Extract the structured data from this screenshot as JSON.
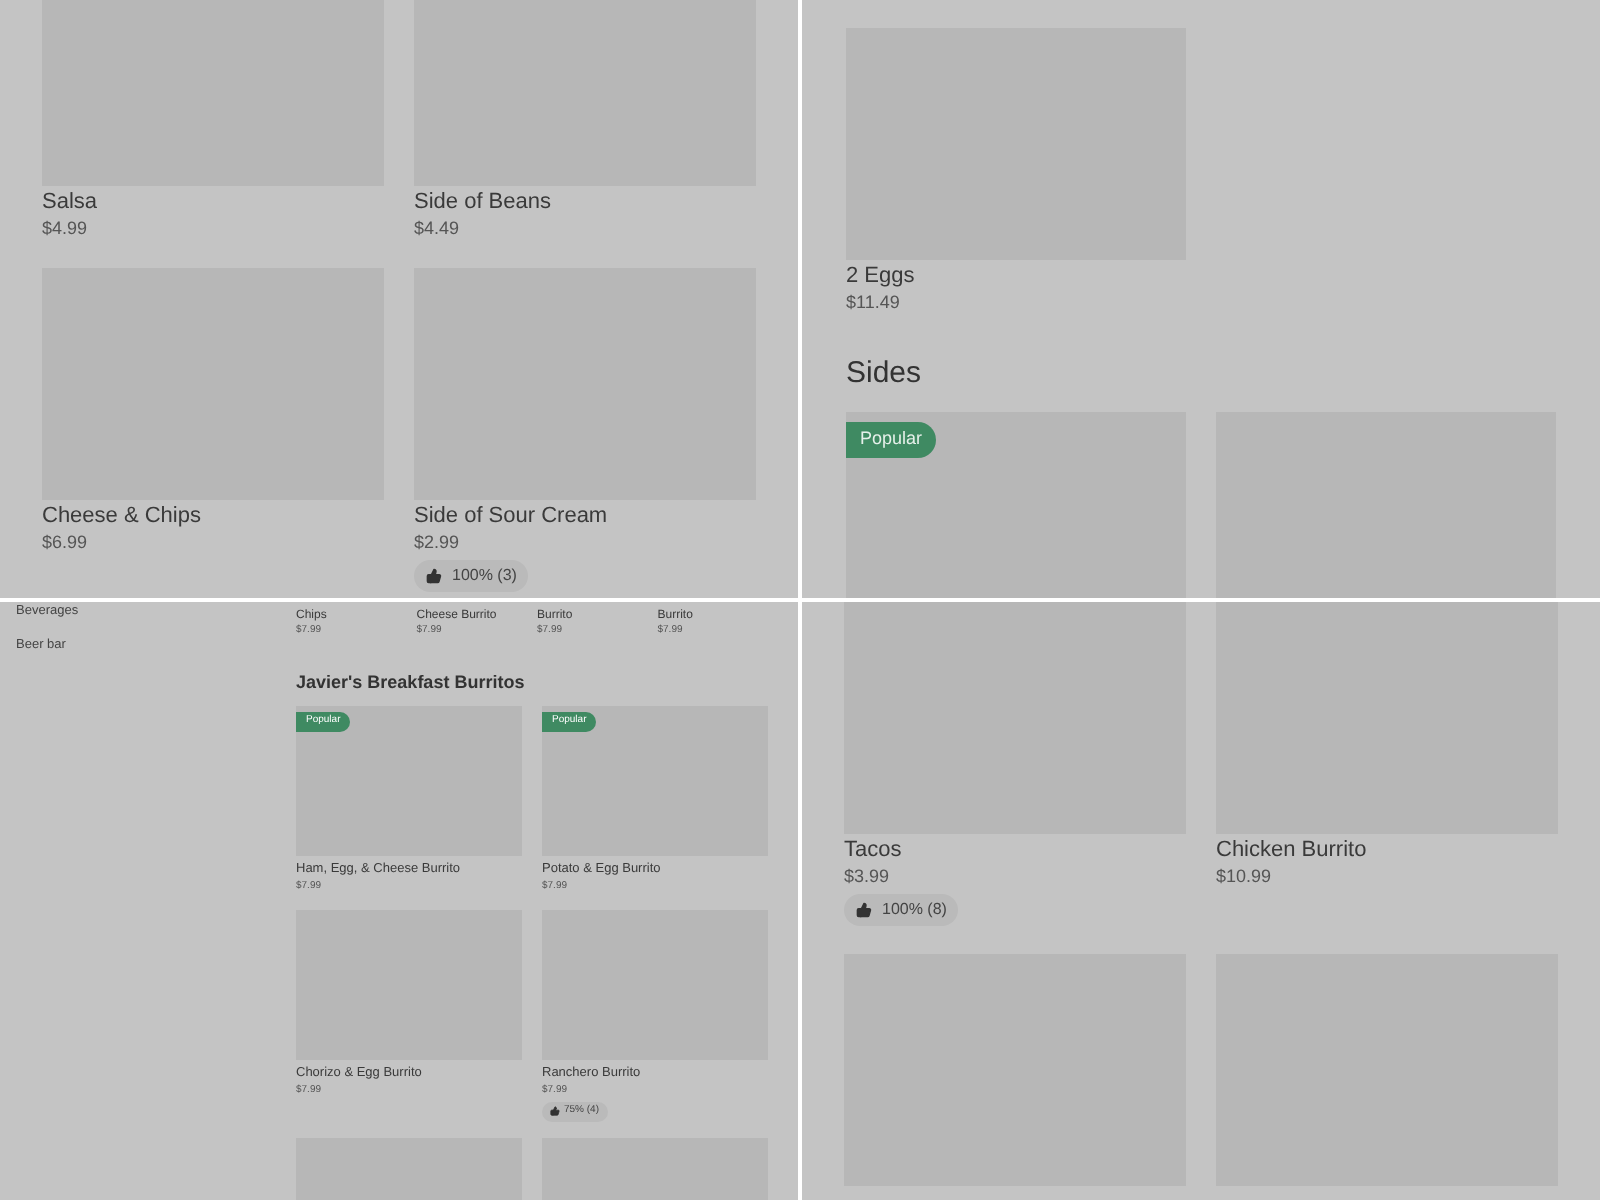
{
  "panels": [
    {
      "kind": "grid",
      "items": [
        {
          "kind": "dish",
          "name": "Salsa",
          "price": "$4.99"
        },
        {
          "kind": "dish",
          "name": "Side of Beans",
          "price": "$4.49"
        },
        {
          "kind": "dish",
          "name": "Cheese & Chips",
          "price": "$6.99"
        },
        {
          "kind": "dish",
          "name": "Side of Sour Cream",
          "price": "$2.99",
          "rating": "100% (3)"
        }
      ]
    },
    {
      "kind": "sections",
      "sections": [
        {
          "items": [
            {
              "kind": "dish",
              "name": "2 Eggs",
              "price": "$11.49"
            }
          ]
        },
        {
          "title": "Sides",
          "items": [
            {
              "kind": "picture",
              "badge": "Popular"
            },
            {
              "kind": "picture"
            }
          ]
        }
      ]
    },
    {
      "kind": "sidebar_menu",
      "sidebar": [
        "Beverages",
        "Beer bar"
      ],
      "top_items": [
        {
          "name": "Chips",
          "price": "$7.99"
        },
        {
          "name": "Cheese Burrito",
          "price": "$7.99"
        },
        {
          "name": "Burrito",
          "price": "$7.99"
        },
        {
          "name": "Burrito",
          "price": "$7.99"
        }
      ],
      "section": {
        "title": "Javier's Breakfast Burritos",
        "items": [
          {
            "kind": "dish",
            "name": "Ham, Egg, & Cheese Burrito",
            "price": "$7.99",
            "badge": "Popular"
          },
          {
            "kind": "dish",
            "name": "Potato & Egg Burrito",
            "price": "$7.99",
            "badge": "Popular"
          },
          {
            "kind": "dish",
            "name": "Chorizo & Egg Burrito",
            "price": "$7.99"
          },
          {
            "kind": "dish",
            "name": "Ranchero Burrito",
            "price": "$7.99",
            "rating": "75% (4)"
          },
          {
            "kind": "picture"
          },
          {
            "kind": "picture"
          }
        ]
      }
    },
    {
      "kind": "grid",
      "items": [
        {
          "kind": "dish",
          "name": "Tacos",
          "price": "$3.99",
          "rating": "100% (8)"
        },
        {
          "kind": "dish",
          "name": "Chicken Burrito",
          "price": "$10.99"
        },
        {
          "kind": "picture"
        },
        {
          "kind": "picture"
        }
      ]
    }
  ]
}
